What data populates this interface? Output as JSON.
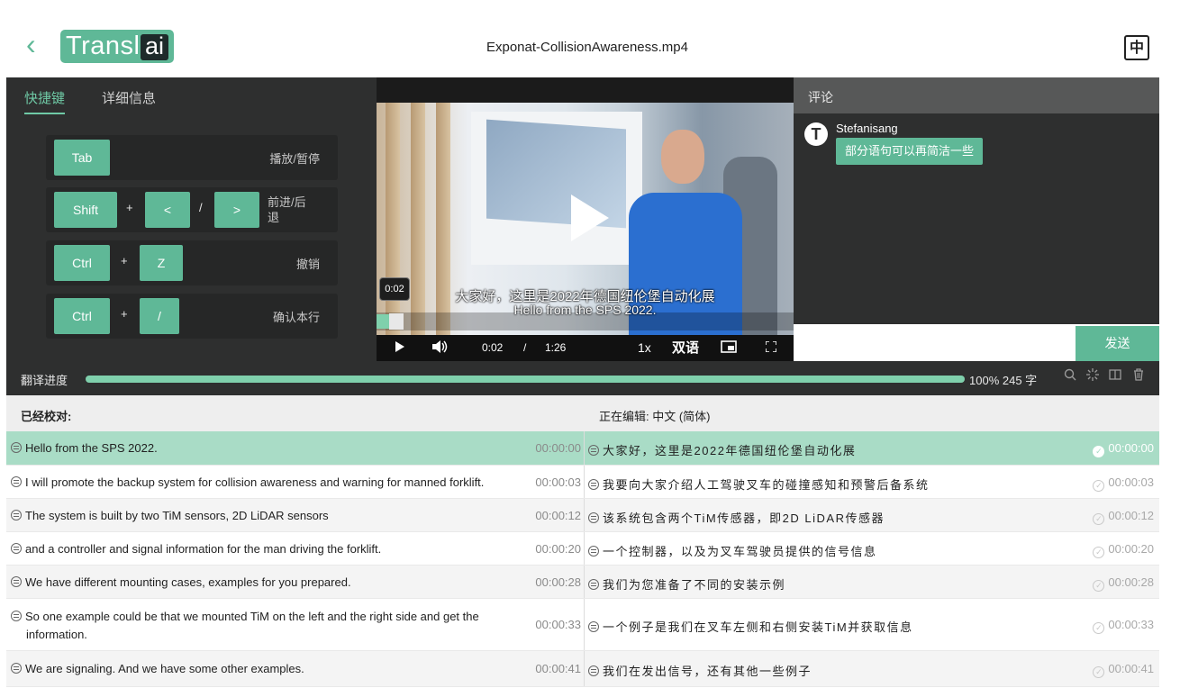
{
  "header": {
    "back_icon": "chevron-left-icon",
    "logo": {
      "text": "Transl",
      "badge": "ai"
    },
    "file_name": "Exponat-CollisionAwareness.mp4",
    "lang_button": "中"
  },
  "left_panel": {
    "tabs": [
      {
        "label": "快捷键",
        "active": true
      },
      {
        "label": "详细信息",
        "active": false
      }
    ],
    "shortcuts": [
      {
        "keys": [
          "Tab"
        ],
        "separators": [],
        "label": "播放/暂停"
      },
      {
        "keys": [
          "Shift",
          "<",
          ">"
        ],
        "separators": [
          "+",
          "/"
        ],
        "label": "前进/后退"
      },
      {
        "keys": [
          "Ctrl",
          "Z"
        ],
        "separators": [
          "+"
        ],
        "label": "撤销"
      },
      {
        "keys": [
          "Ctrl",
          "/"
        ],
        "separators": [
          "+"
        ],
        "label": "确认本行"
      }
    ]
  },
  "video": {
    "time_tip": "0:02",
    "subtitle_cn": "大家好，这里是2022年德国纽伦堡自动化展",
    "subtitle_en": "Hello from the SPS 2022.",
    "progress": 0.03,
    "controls": {
      "play_icon": "play-icon",
      "volume_icon": "volume-icon",
      "current_time": "0:02",
      "time_sep": "/",
      "duration": "1:26",
      "speed": "1x",
      "dual_lang": "双语",
      "pip_icon": "picture-in-picture-icon",
      "fullscreen_icon": "fullscreen-icon"
    }
  },
  "comments": {
    "title": "评论",
    "items": [
      {
        "avatar": "T",
        "user": "Stefanisang",
        "text": "部分语句可以再简洁一些"
      }
    ],
    "input_placeholder": "",
    "send_label": "发送"
  },
  "progress": {
    "label": "翻译进度",
    "percent": 100,
    "summary": "100% 245 字",
    "icons": [
      "search-icon",
      "settings-icon",
      "split-view-icon",
      "trash-icon"
    ]
  },
  "table": {
    "left_header": "已经校对:",
    "right_header": "正在编辑:  中文 (简体)",
    "rows": [
      {
        "src": "Hello from the SPS 2022.",
        "src_time": "00:00:00",
        "tgt": "大家好，这里是2022年德国纽伦堡自动化展",
        "tgt_time": "00:00:00",
        "selected": true
      },
      {
        "src": "I will promote the backup system for collision awareness and warning for manned forklift.",
        "src_time": "00:00:03",
        "tgt": "我要向大家介绍人工驾驶叉车的碰撞感知和预警后备系统",
        "tgt_time": "00:00:03",
        "selected": false
      },
      {
        "src": "The system is built by two TiM sensors, 2D LiDAR sensors",
        "src_time": "00:00:12",
        "tgt": "该系统包含两个TiM传感器，即2D LiDAR传感器",
        "tgt_time": "00:00:12",
        "selected": false
      },
      {
        "src": "and a controller and signal information for the man driving the forklift.",
        "src_time": "00:00:20",
        "tgt": "一个控制器，以及为叉车驾驶员提供的信号信息",
        "tgt_time": "00:00:20",
        "selected": false
      },
      {
        "src": "We have different mounting cases, examples for you prepared.",
        "src_time": "00:00:28",
        "tgt": "我们为您准备了不同的安装示例",
        "tgt_time": "00:00:28",
        "selected": false
      },
      {
        "src": "So one example could be that we mounted TiM on the left and the right side and get the information.",
        "src_time": "00:00:33",
        "tgt": "一个例子是我们在叉车左侧和右侧安装TiM并获取信息",
        "tgt_time": "00:00:33",
        "selected": false
      },
      {
        "src": "We are signaling. And we have some other examples.",
        "src_time": "00:00:41",
        "tgt": "我们在发出信号，还有其他一些例子",
        "tgt_time": "00:00:41",
        "selected": false
      }
    ]
  },
  "colors": {
    "accent": "#5fb897",
    "dark_panel": "#2e2f2f",
    "selected_row": "#a9dcc6"
  }
}
